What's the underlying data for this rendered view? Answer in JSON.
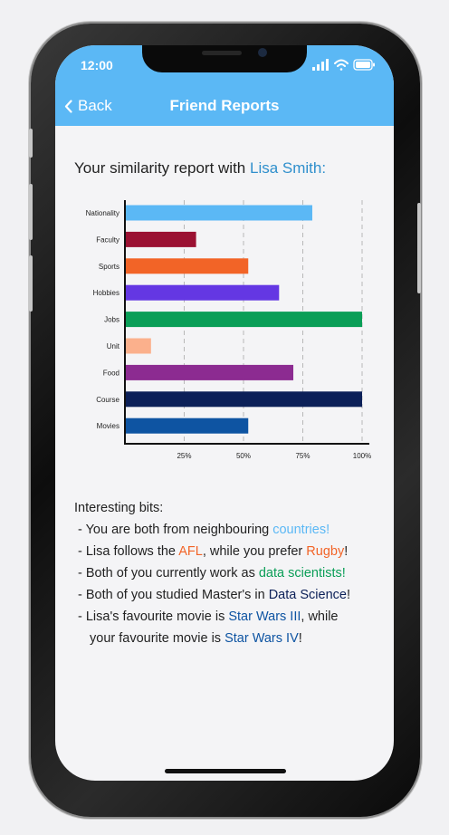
{
  "status": {
    "time": "12:00"
  },
  "nav": {
    "back_label": "Back",
    "title": "Friend Reports"
  },
  "report": {
    "heading_prefix": "Your similarity report with ",
    "friend_name": "Lisa Smith:"
  },
  "chart_data": {
    "type": "bar",
    "orientation": "horizontal",
    "categories": [
      "Nationality",
      "Faculty",
      "Sports",
      "Hobbies",
      "Jobs",
      "Unit",
      "Food",
      "Course",
      "Movies"
    ],
    "values": [
      79,
      30,
      52,
      65,
      100,
      11,
      71,
      100,
      52
    ],
    "colors": [
      "#5bb8f5",
      "#9b1132",
      "#f26427",
      "#6437e3",
      "#0a9e57",
      "#fbb08c",
      "#8c2b91",
      "#0c2058",
      "#0e54a2"
    ],
    "x_ticks": [
      "25%",
      "50%",
      "75%",
      "100%"
    ],
    "xlim": [
      0,
      100
    ],
    "grid": "dashed vertical at ticks"
  },
  "bits": {
    "title": "Interesting bits:",
    "lines": [
      [
        {
          "t": "- You are both from neighbouring "
        },
        {
          "t": "countries!",
          "c": "#5bb8f5"
        }
      ],
      [
        {
          "t": "- Lisa follows the "
        },
        {
          "t": "AFL",
          "c": "#f26427"
        },
        {
          "t": ", while you prefer "
        },
        {
          "t": "Rugby",
          "c": "#f26427"
        },
        {
          "t": "!"
        }
      ],
      [
        {
          "t": "- Both of you currently work as "
        },
        {
          "t": "data scientists!",
          "c": "#0a9e57"
        }
      ],
      [
        {
          "t": "- Both of you studied Master's in "
        },
        {
          "t": "Data Science",
          "c": "#0c2058"
        },
        {
          "t": "!"
        }
      ],
      [
        {
          "t": "- Lisa's favourite movie is "
        },
        {
          "t": "Star Wars III",
          "c": "#0e54a2"
        },
        {
          "t": ", while"
        }
      ],
      [
        {
          "t": "your favourite movie is "
        },
        {
          "t": "Star Wars IV",
          "c": "#0e54a2"
        },
        {
          "t": "!"
        }
      ]
    ]
  }
}
